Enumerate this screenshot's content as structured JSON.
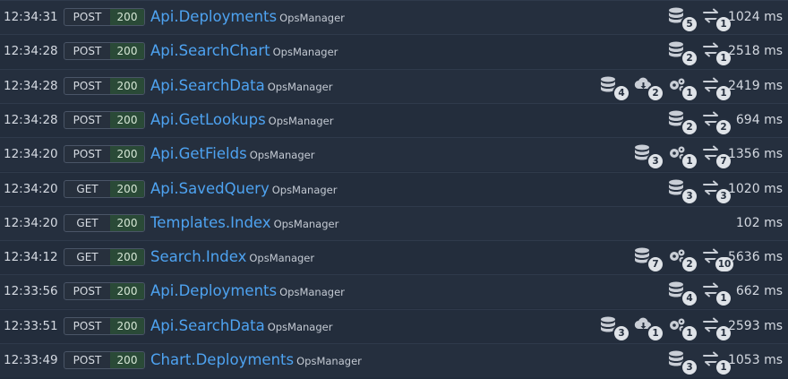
{
  "app_label": "OpsManager",
  "rows": [
    {
      "time": "12:34:31",
      "method": "POST",
      "status": "200",
      "route": "Api.Deployments",
      "db": "5",
      "http": "1",
      "duration": "1024 ms"
    },
    {
      "time": "12:34:28",
      "method": "POST",
      "status": "200",
      "route": "Api.SearchChart",
      "db": "2",
      "http": "1",
      "duration": "2518 ms"
    },
    {
      "time": "12:34:28",
      "method": "POST",
      "status": "200",
      "route": "Api.SearchData",
      "db": "4",
      "cloud": "2",
      "cache": "1",
      "http": "1",
      "duration": "2419 ms"
    },
    {
      "time": "12:34:28",
      "method": "POST",
      "status": "200",
      "route": "Api.GetLookups",
      "db": "2",
      "http": "2",
      "duration": "694 ms"
    },
    {
      "time": "12:34:20",
      "method": "POST",
      "status": "200",
      "route": "Api.GetFields",
      "db": "3",
      "cache": "1",
      "http": "7",
      "duration": "1356 ms"
    },
    {
      "time": "12:34:20",
      "method": "GET",
      "status": "200",
      "route": "Api.SavedQuery",
      "db": "3",
      "http": "3",
      "duration": "1020 ms"
    },
    {
      "time": "12:34:20",
      "method": "GET",
      "status": "200",
      "route": "Templates.Index",
      "duration": "102 ms"
    },
    {
      "time": "12:34:12",
      "method": "GET",
      "status": "200",
      "route": "Search.Index",
      "db": "7",
      "cache": "2",
      "http": "10",
      "duration": "5636 ms"
    },
    {
      "time": "12:33:56",
      "method": "POST",
      "status": "200",
      "route": "Api.Deployments",
      "db": "4",
      "http": "1",
      "duration": "662 ms"
    },
    {
      "time": "12:33:51",
      "method": "POST",
      "status": "200",
      "route": "Api.SearchData",
      "db": "3",
      "cloud": "1",
      "cache": "1",
      "http": "1",
      "duration": "2593 ms"
    },
    {
      "time": "12:33:49",
      "method": "POST",
      "status": "200",
      "route": "Chart.Deployments",
      "db": "3",
      "http": "1",
      "duration": "1053 ms"
    }
  ]
}
